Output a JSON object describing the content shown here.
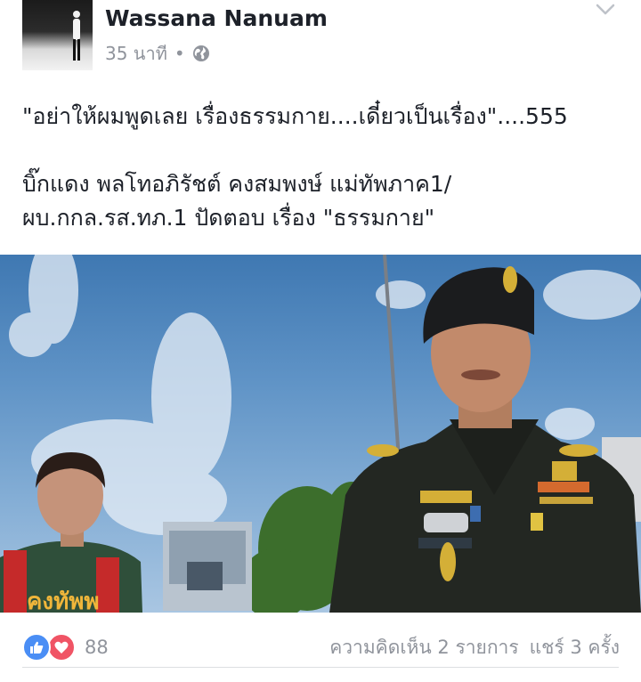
{
  "post": {
    "author": "Wassana Nanuam",
    "time": "35 นาที",
    "separator": "•",
    "privacy_icon": "globe-icon",
    "menu_icon": "chevron-down-icon",
    "text_line1": "\"อย่าให้ผมพูดเลย เรื่องธรรมกาย....เดี๋ยวเป็นเรื่อง\"....555",
    "text_line2": "บิ๊กแดง พลโทอภิรัชต์ คงสมพงษ์ แม่ทัพภาค1/",
    "text_line3": "ผบ.กกล.รส.ทภ.1 ปัดตอบ เรื่อง \"ธรรมกาย\"",
    "photo_shirt_text": "คงทัพพ"
  },
  "footer": {
    "reactions": [
      "like-icon",
      "love-icon"
    ],
    "reaction_count": "88",
    "comments": "ความคิดเห็น 2 รายการ",
    "shares": "แชร์ 3 ครั้ง"
  },
  "colors": {
    "like": "#4a8ef5",
    "love": "#f05465",
    "meta_text": "#90949c"
  }
}
